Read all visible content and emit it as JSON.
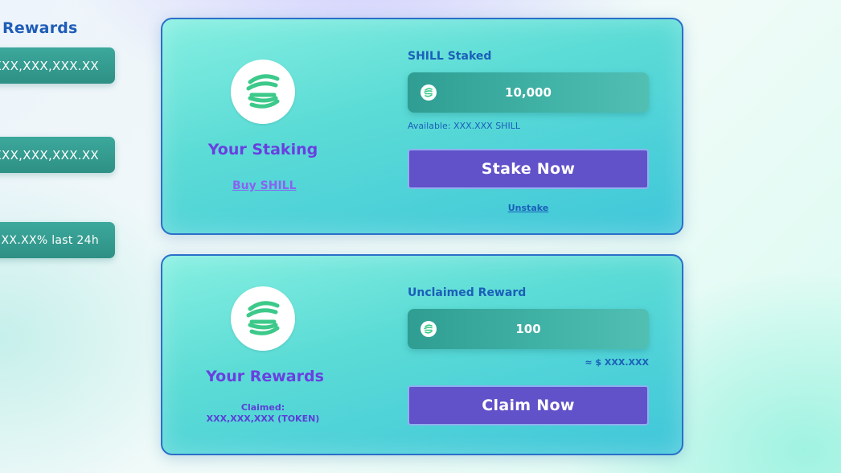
{
  "left": {
    "title": "Rewards",
    "pill_1": "XXX,XXX,XXX.XX",
    "pill_2": "XXX,XXX,XXX.XX",
    "pill_3": "XX.XX% last 24h"
  },
  "staking": {
    "title": "Your Staking",
    "buy_link": "Buy SHILL",
    "field_label": "SHILL Staked",
    "amount": "10,000",
    "available": "Available: XXX.XXX SHILL",
    "button": "Stake Now",
    "unstake": "Unstake"
  },
  "rewards": {
    "title": "Your Rewards",
    "claimed_label": "Claimed:",
    "claimed_value": "XXX,XXX,XXX (TOKEN)",
    "field_label": "Unclaimed Reward",
    "amount": "100",
    "usd_value": "≈ $ XXX.XXX",
    "button": "Claim Now"
  },
  "icons": {
    "logo": "shill-logo-icon",
    "coin": "shill-coin-icon"
  },
  "colors": {
    "accent_purple": "#6152c9",
    "title_purple": "#6a3fe0",
    "label_blue": "#1b5fb8",
    "field_teal": "#2f9d92",
    "logo_green": "#3cc98a"
  }
}
